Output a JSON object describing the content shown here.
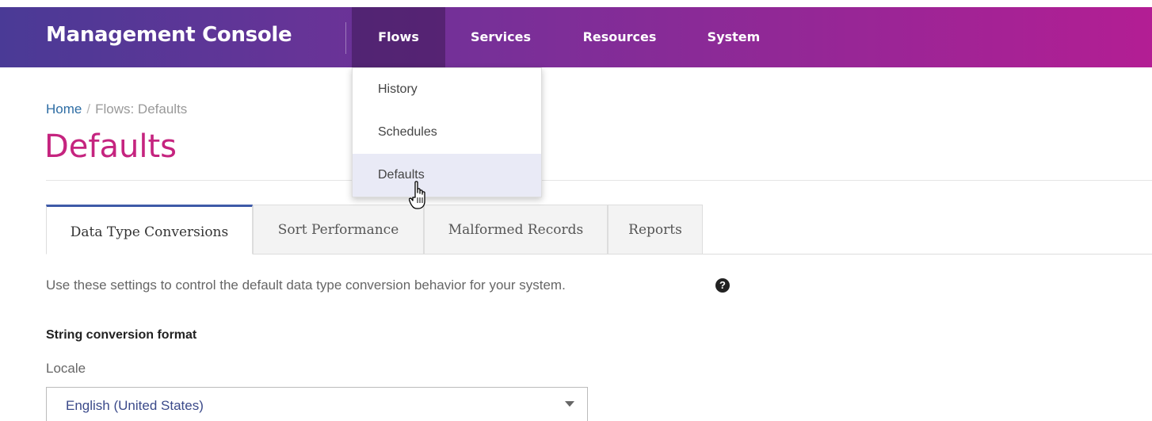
{
  "header": {
    "brand": "Management Console",
    "nav": [
      {
        "label": "Flows",
        "active": true
      },
      {
        "label": "Services"
      },
      {
        "label": "Resources"
      },
      {
        "label": "System"
      }
    ]
  },
  "flows_menu": {
    "items": [
      "History",
      "Schedules",
      "Defaults"
    ],
    "hovered": "Defaults"
  },
  "breadcrumb": {
    "home": "Home",
    "separator": "/",
    "current": "Flows: Defaults"
  },
  "page_title": "Defaults",
  "tabs": [
    {
      "label": "Data Type Conversions",
      "active": true
    },
    {
      "label": "Sort Performance"
    },
    {
      "label": "Malformed Records"
    },
    {
      "label": "Reports"
    }
  ],
  "description": "Use these settings to control the default data type conversion behavior for your system.",
  "help_icon": "question-circle-icon",
  "section": {
    "title": "String conversion format",
    "locale_label": "Locale",
    "locale_value": "English (United States)"
  },
  "colors": {
    "header_gradient_start": "#4a3a96",
    "header_gradient_end": "#b31e94",
    "title": "#c5247f",
    "active_tab_border": "#3e5aa8",
    "link": "#2e6da4"
  }
}
